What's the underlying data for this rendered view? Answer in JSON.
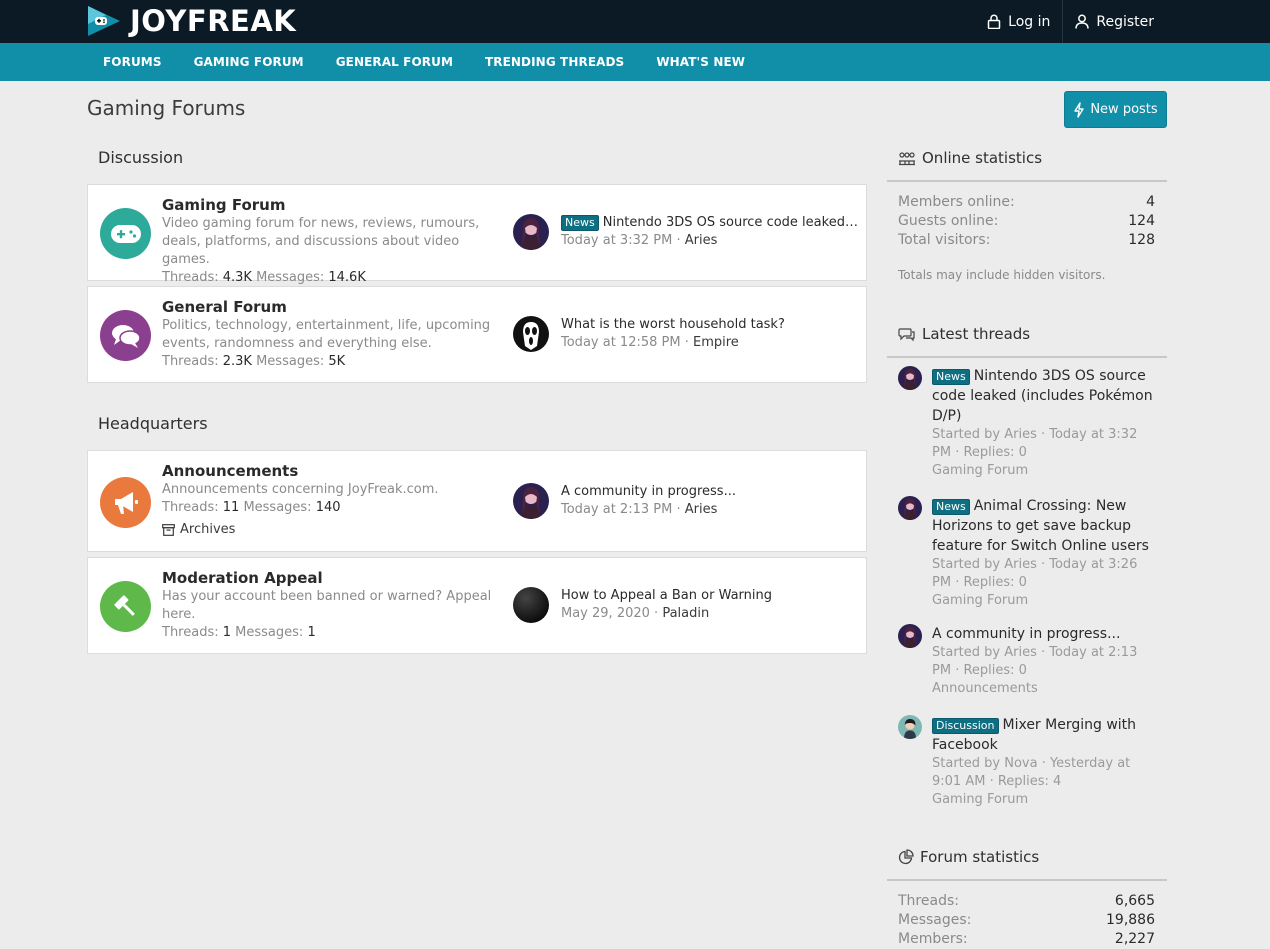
{
  "brand": {
    "name": "JOYFREAK"
  },
  "top_actions": {
    "login": "Log in",
    "register": "Register"
  },
  "nav": [
    "FORUMS",
    "GAMING FORUM",
    "GENERAL FORUM",
    "TRENDING THREADS",
    "WHAT'S NEW"
  ],
  "page": {
    "title": "Gaming Forums",
    "new_posts": "New posts"
  },
  "sections": [
    {
      "title": "Discussion",
      "nodes": [
        {
          "title": "Gaming Forum",
          "desc": "Video gaming forum for news, reviews, rumours, deals, platforms, and discussions about video games.",
          "threads_label": "Threads:",
          "threads": "4.3K",
          "messages_label": "Messages:",
          "messages": "14.6K",
          "icon": "gamepad-icon",
          "icon_color": "#2eaa9a",
          "latest": {
            "label": "News",
            "title": "Nintendo 3DS OS source code leaked (...",
            "time": "Today at 3:32 PM",
            "user": "Aries",
            "avatar": "aries"
          }
        },
        {
          "title": "General Forum",
          "desc": "Politics, technology, entertainment, life, upcoming events, randomness and everything else.",
          "threads_label": "Threads:",
          "threads": "2.3K",
          "messages_label": "Messages:",
          "messages": "5K",
          "icon": "chat-bubbles-icon",
          "icon_color": "#8b3f8f",
          "latest": {
            "label": "",
            "title": "What is the worst household task?",
            "time": "Today at 12:58 PM",
            "user": "Empire",
            "avatar": "empire"
          }
        }
      ]
    },
    {
      "title": "Headquarters",
      "nodes": [
        {
          "title": "Announcements",
          "desc": "Announcements concerning JoyFreak.com.",
          "threads_label": "Threads:",
          "threads": "11",
          "messages_label": "Messages:",
          "messages": "140",
          "extra": "Archives",
          "icon": "megaphone-icon",
          "icon_color": "#e9793d",
          "latest": {
            "label": "",
            "title": "A community in progress...",
            "time": "Today at 2:13 PM",
            "user": "Aries",
            "avatar": "aries"
          }
        },
        {
          "title": "Moderation Appeal",
          "desc": "Has your account been banned or warned? Appeal here.",
          "threads_label": "Threads:",
          "threads": "1",
          "messages_label": "Messages:",
          "messages": "1",
          "icon": "gavel-icon",
          "icon_color": "#5fb94a",
          "latest": {
            "label": "",
            "title": "How to Appeal a Ban or Warning",
            "time": "May 29, 2020",
            "user": "Paladin",
            "avatar": "paladin"
          }
        }
      ]
    }
  ],
  "online_stats": {
    "title": "Online statistics",
    "rows": [
      {
        "label": "Members online:",
        "value": "4"
      },
      {
        "label": "Guests online:",
        "value": "124"
      },
      {
        "label": "Total visitors:",
        "value": "128"
      }
    ],
    "note": "Totals may include hidden visitors."
  },
  "latest_threads": {
    "title": "Latest threads",
    "items": [
      {
        "label": "News",
        "title": "Nintendo 3DS OS source code leaked (includes Pokémon D/P)",
        "meta": "Started by Aries · Today at 3:32 PM · Replies: 0",
        "forum": "Gaming Forum",
        "avatar": "aries"
      },
      {
        "label": "News",
        "title": "Animal Crossing: New Horizons to get save backup feature for Switch Online users",
        "meta": "Started by Aries · Today at 3:26 PM · Replies: 0",
        "forum": "Gaming Forum",
        "avatar": "aries"
      },
      {
        "label": "",
        "title": "A community in progress...",
        "meta": "Started by Aries · Today at 2:13 PM · Replies: 0",
        "forum": "Announcements",
        "avatar": "aries"
      },
      {
        "label": "Discussion",
        "title": "Mixer Merging with Facebook",
        "meta": "Started by Nova · Yesterday at 9:01 AM · Replies: 4",
        "forum": "Gaming Forum",
        "avatar": "nova"
      }
    ]
  },
  "forum_stats": {
    "title": "Forum statistics",
    "rows": [
      {
        "label": "Threads:",
        "value": "6,665"
      },
      {
        "label": "Messages:",
        "value": "19,886"
      },
      {
        "label": "Members:",
        "value": "2,227"
      }
    ]
  },
  "colors": {
    "topbar": "#0b1a24",
    "navbar": "#128fa8",
    "accent": "#128fa8",
    "label": "#0e6e82"
  }
}
